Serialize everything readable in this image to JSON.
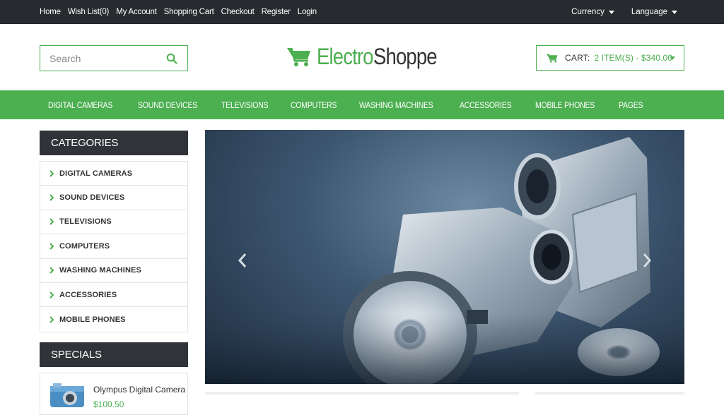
{
  "topbar": {
    "links": [
      "Home",
      "Wish List(0)",
      "My Account",
      "Shopping Cart",
      "Checkout",
      "Register",
      "Login"
    ],
    "currency_label": "Currency",
    "language_label": "Language"
  },
  "search": {
    "placeholder": "Search"
  },
  "logo": {
    "part1": "Electro",
    "part2": "Shoppe"
  },
  "cart": {
    "label": "CART:",
    "value": "2 ITEM(S) - $340.00"
  },
  "nav": [
    "DIGITAL CAMERAS",
    "SOUND DEVICES",
    "TELEVISIONS",
    "COMPUTERS",
    "WASHING MACHINES",
    "ACCESSORIES",
    "MOBILE PHONES",
    "PAGES"
  ],
  "sidebar": {
    "categories_title": "CATEGORIES",
    "categories": [
      "DIGITAL CAMERAS",
      "SOUND DEVICES",
      "TELEVISIONS",
      "COMPUTERS",
      "WASHING MACHINES",
      "ACCESSORIES",
      "MOBILE PHONES"
    ],
    "specials_title": "SPECIALS",
    "special_item": {
      "name": "Olympus Digital Camera",
      "price": "$100.50"
    }
  },
  "colors": {
    "accent": "#4caf50",
    "dark": "#272a2e"
  },
  "icons": {
    "search": "search-icon",
    "cart": "cart-icon",
    "chevron": "chevron-right-icon"
  }
}
